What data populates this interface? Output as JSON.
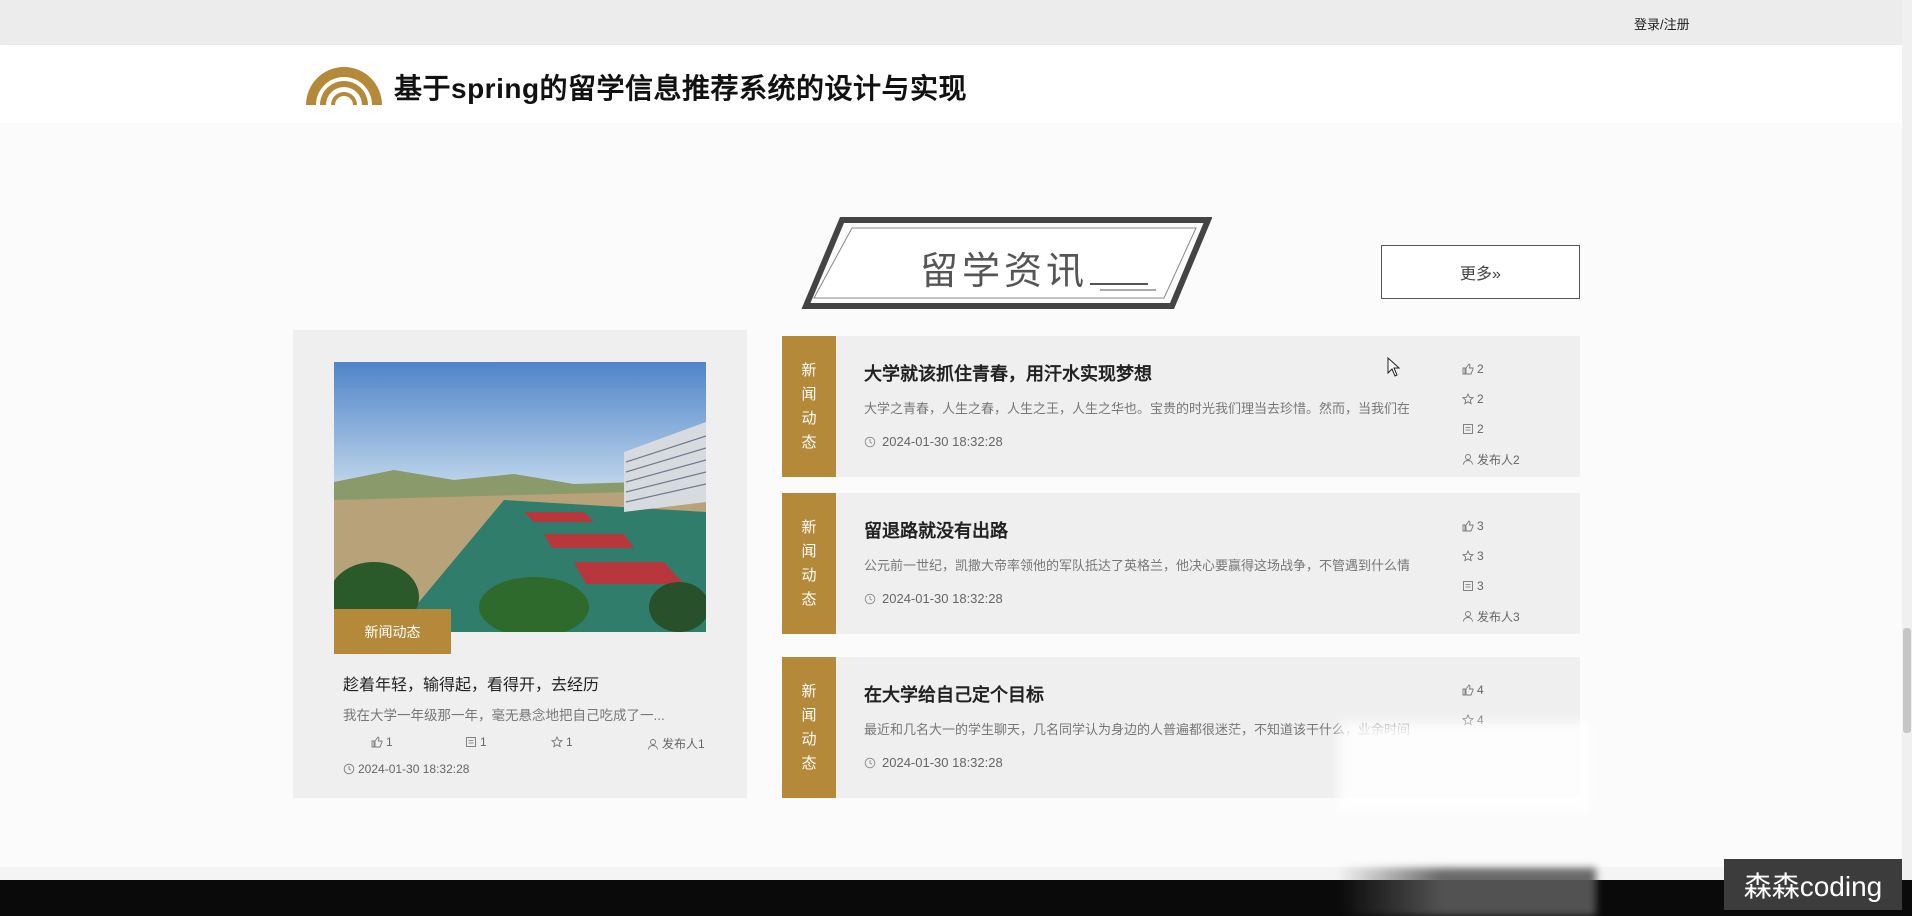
{
  "topbar": {
    "login_label": "登录/注册"
  },
  "header": {
    "site_title": "基于spring的留学信息推荐系统的设计与实现"
  },
  "section": {
    "title": "留学资讯",
    "more_label": "更多»"
  },
  "featured": {
    "tag": "新闻动态",
    "title": "趁着年轻，输得起，看得开，去经历",
    "summary": "我在大学一年级那一年，毫无悬念地把自己吃成了一...",
    "likes": "1",
    "comments": "1",
    "favorites": "1",
    "publisher": "发布人1",
    "date": "2024-01-30 18:32:28"
  },
  "news": [
    {
      "category": [
        "新",
        "闻",
        "动",
        "态"
      ],
      "title": "大学就该抓住青春，用汗水实现梦想",
      "summary": "大学之青春，人生之春，人生之王，人生之华也。宝贵的时光我们理当去珍惜。然而，当我们在青",
      "date": "2024-01-30 18:32:28",
      "likes": "2",
      "favorites": "2",
      "comments": "2",
      "publisher": "发布人2"
    },
    {
      "category": [
        "新",
        "闻",
        "动",
        "态"
      ],
      "title": "留退路就没有出路",
      "summary": "公元前一世纪，凯撒大帝率领他的军队抵达了英格兰，他决心要赢得这场战争，不管遇到什么情况",
      "date": "2024-01-30 18:32:28",
      "likes": "3",
      "favorites": "3",
      "comments": "3",
      "publisher": "发布人3"
    },
    {
      "category": [
        "新",
        "闻",
        "动",
        "态"
      ],
      "title": "在大学给自己定个目标",
      "summary": "最近和几名大一的学生聊天，几名同学认为身边的人普遍都很迷茫，不知道该干什么，业余时间要",
      "date": "2024-01-30 18:32:28",
      "likes": "4",
      "favorites": "4"
    }
  ],
  "watermark": "森森coding",
  "colors": {
    "accent": "#b5893a",
    "background": "#fbfbfb"
  }
}
